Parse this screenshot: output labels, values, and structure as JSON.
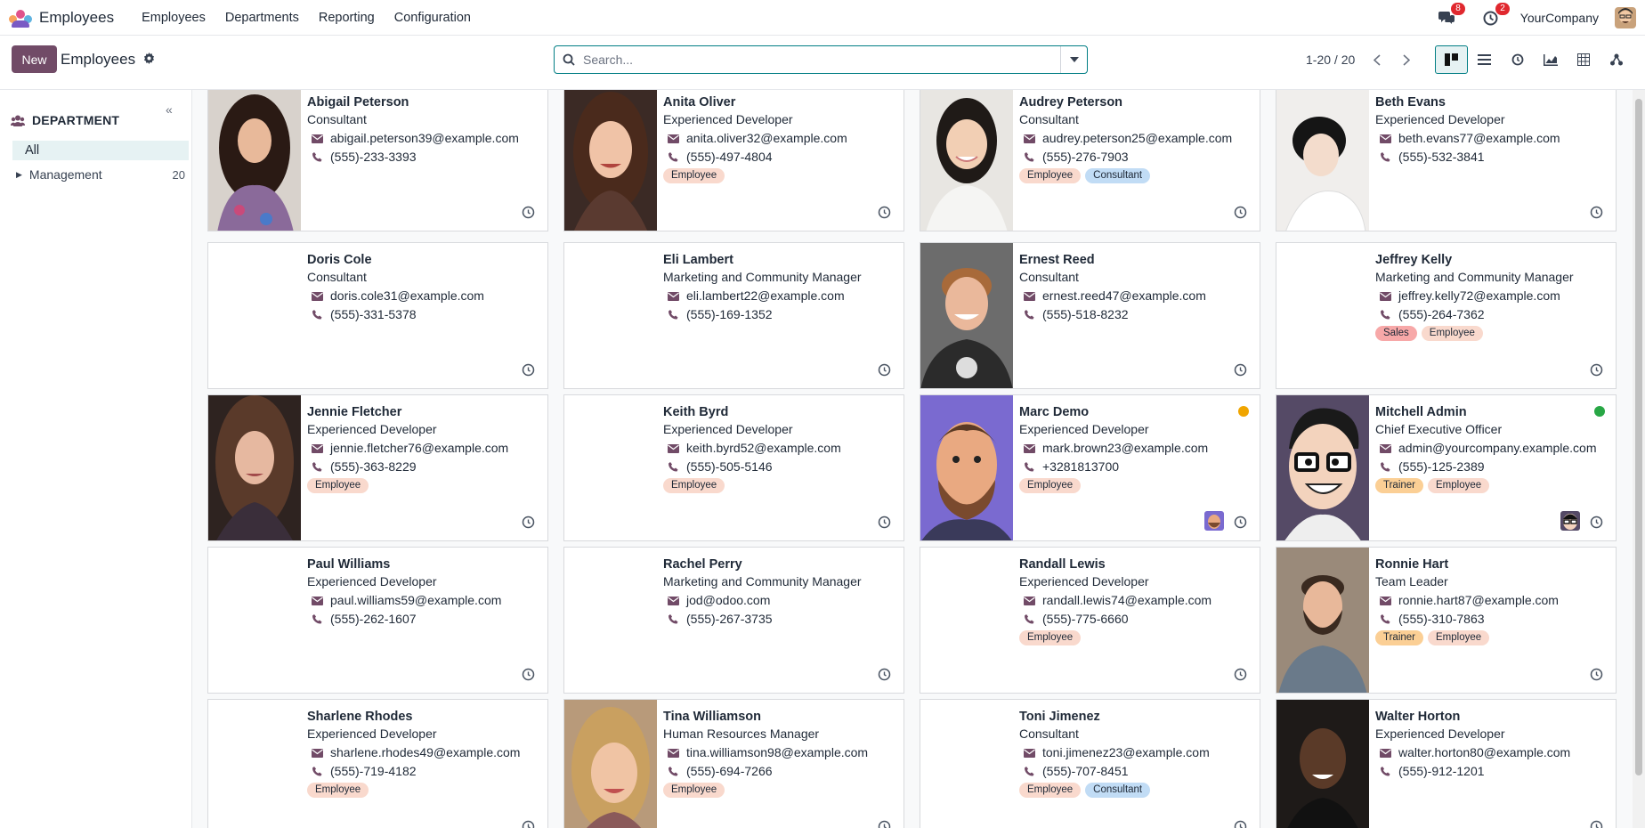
{
  "navbar": {
    "app_name": "Employees",
    "menu": [
      "Employees",
      "Departments",
      "Reporting",
      "Configuration"
    ],
    "messages_count": "8",
    "activities_count": "2",
    "company": "YourCompany"
  },
  "control": {
    "new_label": "New",
    "breadcrumb": "Employees",
    "search_placeholder": "Search...",
    "pager": "1-20 / 20",
    "views": [
      "kanban-view-icon",
      "list-view-icon",
      "activity-view-icon",
      "graph-view-icon",
      "pivot-view-icon",
      "hierarchy-view-icon"
    ]
  },
  "sidebar": {
    "header": "DEPARTMENT",
    "all_label": "All",
    "items": [
      {
        "label": "Management",
        "count": "20"
      }
    ]
  },
  "colors": {
    "accent": "#714b67",
    "teal": "#017e84",
    "employee_tag": "#f9d9cd",
    "consultant_tag": "#c1dcf5",
    "sales_tag": "#f7a8a8",
    "trainer_tag": "#fbcf95"
  },
  "employees": [
    {
      "name": "Abigail Peterson",
      "job": "Consultant",
      "email": "abigail.peterson39@example.com",
      "phone": "(555)-233-3393",
      "tags": [],
      "photo": "woman-curly-dark"
    },
    {
      "name": "Anita Oliver",
      "job": "Experienced Developer",
      "email": "anita.oliver32@example.com",
      "phone": "(555)-497-4804",
      "tags": [
        "Employee"
      ],
      "photo": "woman-brunette"
    },
    {
      "name": "Audrey Peterson",
      "job": "Consultant",
      "email": "audrey.peterson25@example.com",
      "phone": "(555)-276-7903",
      "tags": [
        "Employee",
        "Consultant"
      ],
      "photo": "woman-asian"
    },
    {
      "name": "Beth Evans",
      "job": "Experienced Developer",
      "email": "beth.evans77@example.com",
      "phone": "(555)-532-3841",
      "tags": [],
      "photo": "woman-short-hair"
    },
    {
      "name": "Doris Cole",
      "job": "Consultant",
      "email": "doris.cole31@example.com",
      "phone": "(555)-331-5378",
      "tags": [],
      "photo": ""
    },
    {
      "name": "Eli Lambert",
      "job": "Marketing and Community Manager",
      "email": "eli.lambert22@example.com",
      "phone": "(555)-169-1352",
      "tags": [],
      "photo": ""
    },
    {
      "name": "Ernest Reed",
      "job": "Consultant",
      "email": "ernest.reed47@example.com",
      "phone": "(555)-518-8232",
      "tags": [],
      "photo": "man-smiling"
    },
    {
      "name": "Jeffrey Kelly",
      "job": "Marketing and Community Manager",
      "email": "jeffrey.kelly72@example.com",
      "phone": "(555)-264-7362",
      "tags": [
        "Sales",
        "Employee"
      ],
      "photo": ""
    },
    {
      "name": "Jennie Fletcher",
      "job": "Experienced Developer",
      "email": "jennie.fletcher76@example.com",
      "phone": "(555)-363-8229",
      "tags": [
        "Employee"
      ],
      "photo": "woman-long-hair"
    },
    {
      "name": "Keith Byrd",
      "job": "Experienced Developer",
      "email": "keith.byrd52@example.com",
      "phone": "(555)-505-5146",
      "tags": [
        "Employee"
      ],
      "photo": ""
    },
    {
      "name": "Marc Demo",
      "job": "Experienced Developer",
      "email": "mark.brown23@example.com",
      "phone": "+3281813700",
      "tags": [
        "Employee"
      ],
      "photo": "cartoon-bearded",
      "presence": "away",
      "mini_avatar": true
    },
    {
      "name": "Mitchell Admin",
      "job": "Chief Executive Officer",
      "email": "admin@yourcompany.example.com",
      "phone": "(555)-125-2389",
      "tags": [
        "Trainer",
        "Employee"
      ],
      "photo": "cartoon-glasses",
      "presence": "online",
      "mini_avatar": true
    },
    {
      "name": "Paul Williams",
      "job": "Experienced Developer",
      "email": "paul.williams59@example.com",
      "phone": "(555)-262-1607",
      "tags": [],
      "photo": ""
    },
    {
      "name": "Rachel Perry",
      "job": "Marketing and Community Manager",
      "email": "jod@odoo.com",
      "phone": "(555)-267-3735",
      "tags": [],
      "photo": ""
    },
    {
      "name": "Randall Lewis",
      "job": "Experienced Developer",
      "email": "randall.lewis74@example.com",
      "phone": "(555)-775-6660",
      "tags": [
        "Employee"
      ],
      "photo": ""
    },
    {
      "name": "Ronnie Hart",
      "job": "Team Leader",
      "email": "ronnie.hart87@example.com",
      "phone": "(555)-310-7863",
      "tags": [
        "Trainer",
        "Employee"
      ],
      "photo": "man-beard"
    },
    {
      "name": "Sharlene Rhodes",
      "job": "Experienced Developer",
      "email": "sharlene.rhodes49@example.com",
      "phone": "(555)-719-4182",
      "tags": [
        "Employee"
      ],
      "photo": ""
    },
    {
      "name": "Tina Williamson",
      "job": "Human Resources Manager",
      "email": "tina.williamson98@example.com",
      "phone": "(555)-694-7266",
      "tags": [
        "Employee"
      ],
      "photo": "woman-blonde"
    },
    {
      "name": "Toni Jimenez",
      "job": "Consultant",
      "email": "toni.jimenez23@example.com",
      "phone": "(555)-707-8451",
      "tags": [
        "Employee",
        "Consultant"
      ],
      "photo": ""
    },
    {
      "name": "Walter Horton",
      "job": "Experienced Developer",
      "email": "walter.horton80@example.com",
      "phone": "(555)-912-1201",
      "tags": [],
      "photo": "man-dark"
    }
  ]
}
